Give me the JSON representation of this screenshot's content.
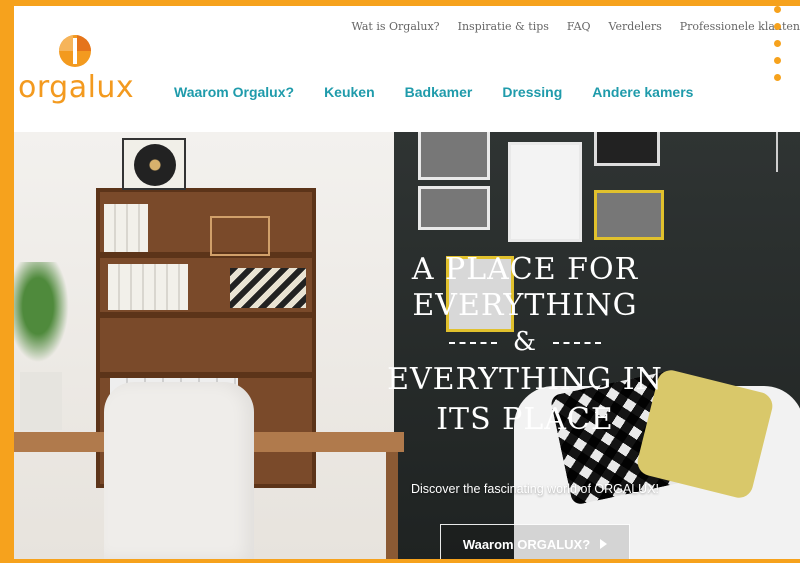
{
  "brand": {
    "name": "orgalux",
    "color": "#f39a1f",
    "nav_color": "#1f9bab",
    "frame_color": "#f6a21d"
  },
  "topnav": {
    "items": [
      {
        "label": "Wat is Orgalux?"
      },
      {
        "label": "Inspiratie & tips"
      },
      {
        "label": "FAQ"
      },
      {
        "label": "Verdelers"
      },
      {
        "label": "Professionele klanten"
      }
    ]
  },
  "mainnav": {
    "items": [
      {
        "label": "Waarom Orgalux?"
      },
      {
        "label": "Keuken"
      },
      {
        "label": "Badkamer"
      },
      {
        "label": "Dressing"
      },
      {
        "label": "Andere kamers"
      }
    ]
  },
  "hero": {
    "line1": "A PLACE FOR EVERYTHING",
    "amp": "&",
    "line3": "EVERYTHING IN ITS PLACE",
    "subtitle": "Discover the fascinating world of ORGALUX!",
    "cta_label": "Waarom ORGALUX?",
    "cta_icon": "play-arrow-icon"
  },
  "icons": {
    "menu": "kebab-menu-icon",
    "logo": "orgalux-logo-icon"
  }
}
